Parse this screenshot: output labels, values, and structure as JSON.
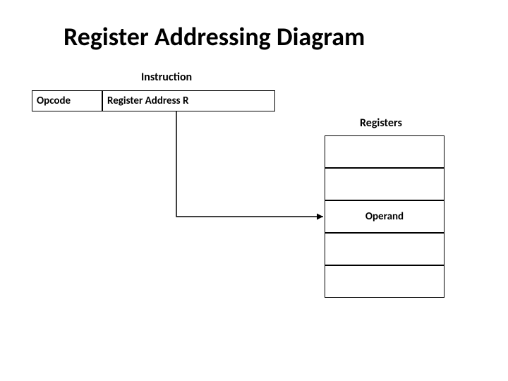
{
  "title": "Register Addressing Diagram",
  "instruction_label": "Instruction",
  "opcode_label": "Opcode",
  "register_address_label": "Register Address R",
  "registers_label": "Registers",
  "operand_label": "Operand",
  "chart_data": {
    "type": "diagram",
    "title": "Register Addressing Diagram",
    "instruction": {
      "fields": [
        "Opcode",
        "Register Address R"
      ]
    },
    "registers": {
      "cells": [
        "",
        "",
        "Operand",
        "",
        ""
      ]
    },
    "arrow": {
      "from": "Register Address R",
      "to": "Registers cell index 2 (Operand)"
    }
  }
}
